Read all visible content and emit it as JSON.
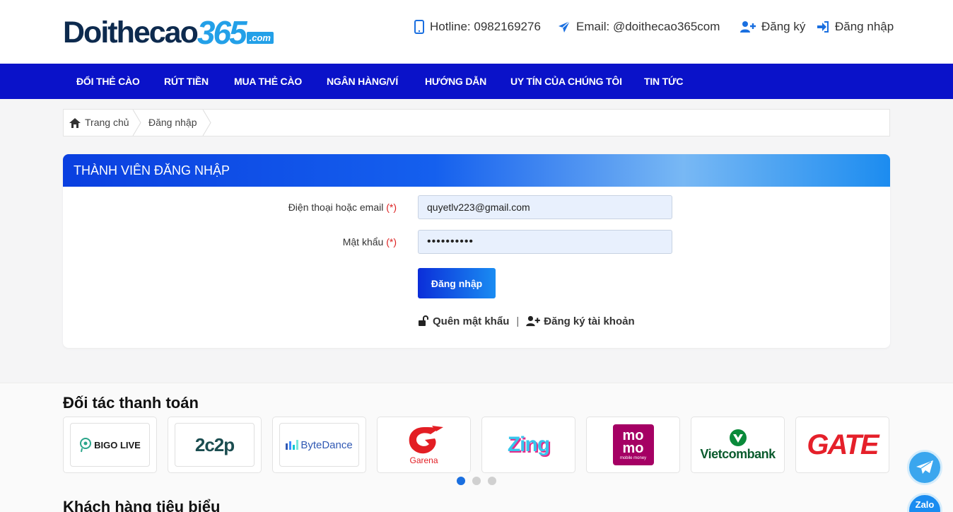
{
  "brand": {
    "part1": "Doithecao",
    "part2": "365",
    "part3": ".com"
  },
  "header": {
    "hotline": "Hotline: 0982169276",
    "email": "Email: @doithecao365com",
    "register": "Đăng ký",
    "login": "Đăng nhập"
  },
  "nav": [
    "ĐỔI THẺ CÀO",
    "RÚT TIỀN",
    "MUA THẺ CÀO",
    "NGÂN HÀNG/VÍ",
    "HƯỚNG DẪN",
    "UY TÍN CỦA CHÚNG TÔI",
    "TIN TỨC"
  ],
  "breadcrumb": {
    "home": "Trang chủ",
    "current": "Đăng nhập"
  },
  "login_form": {
    "title": "THÀNH VIÊN ĐĂNG NHẬP",
    "account_label": "Điện thoại hoặc email",
    "password_label": "Mật khẩu",
    "required_mark": "(*)",
    "account_value": "quyetlv223@gmail.com",
    "password_value": "••••••••••",
    "submit": "Đăng nhập",
    "forgot": "Quên mật khẩu",
    "separator": "|",
    "signup": "Đăng ký tài khoản"
  },
  "partners": {
    "title": "Đối tác thanh toán",
    "logos": [
      "BIGO LIVE",
      "2c2p",
      "ByteDance",
      "Garena",
      "Zing",
      "mo mo",
      "Vietcombank",
      "GATE"
    ],
    "momo_tagline": "mobile money",
    "slide_active": 1,
    "slide_count": 3
  },
  "customers": {
    "title": "Khách hàng tiêu biểu"
  },
  "floating": {
    "zalo": "Zalo"
  },
  "colors": {
    "nav": "#0a12c9",
    "accent": "#1a6fe0",
    "required": "#d22"
  }
}
